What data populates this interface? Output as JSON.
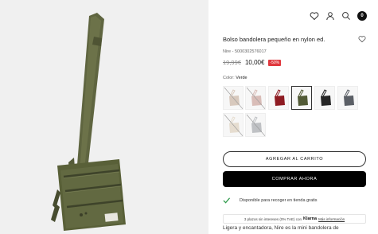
{
  "product": {
    "title": "Bolso bandolera pequeño en nylon ed.",
    "sku": "Nire - 5000302576017",
    "old_price": "19,99€",
    "new_price": "10,00€",
    "discount": "-50%",
    "color_prefix": "Color: ",
    "color_name": "Verde",
    "description_start": "Ligera y encantadora, Nire es la mini bandolera de"
  },
  "header": {
    "cart_count": "0",
    "icons": [
      "heart-icon",
      "user-icon",
      "search-icon",
      "cart-icon"
    ]
  },
  "swatches": [
    {
      "name": "swatch-beige",
      "color": "#d8c9bd",
      "available": false,
      "selected": false
    },
    {
      "name": "swatch-pink",
      "color": "#d9bdb8",
      "available": false,
      "selected": false
    },
    {
      "name": "swatch-red",
      "color": "#8e1b22",
      "available": true,
      "selected": false
    },
    {
      "name": "swatch-green",
      "color": "#525a36",
      "available": true,
      "selected": true
    },
    {
      "name": "swatch-black",
      "color": "#262626",
      "available": true,
      "selected": false
    },
    {
      "name": "swatch-grey",
      "color": "#5b5f66",
      "available": true,
      "selected": false
    },
    {
      "name": "swatch-cream",
      "color": "#e6ddd0",
      "available": false,
      "selected": false
    },
    {
      "name": "swatch-silver",
      "color": "#bfc1c4",
      "available": false,
      "selected": false
    }
  ],
  "actions": {
    "add_to_cart": "AGREGAR AL CARRITO",
    "buy_now": "COMPRAR AHORA"
  },
  "pickup": {
    "text": "Disponible para recoger en tienda gratis"
  },
  "klarna": {
    "text": "3 plazos sin intereses (0% TAE) con",
    "brand": "Klarna",
    "more": "Más información"
  },
  "colors": {
    "accent_red": "#e0383e",
    "product_green": "#525a36"
  }
}
